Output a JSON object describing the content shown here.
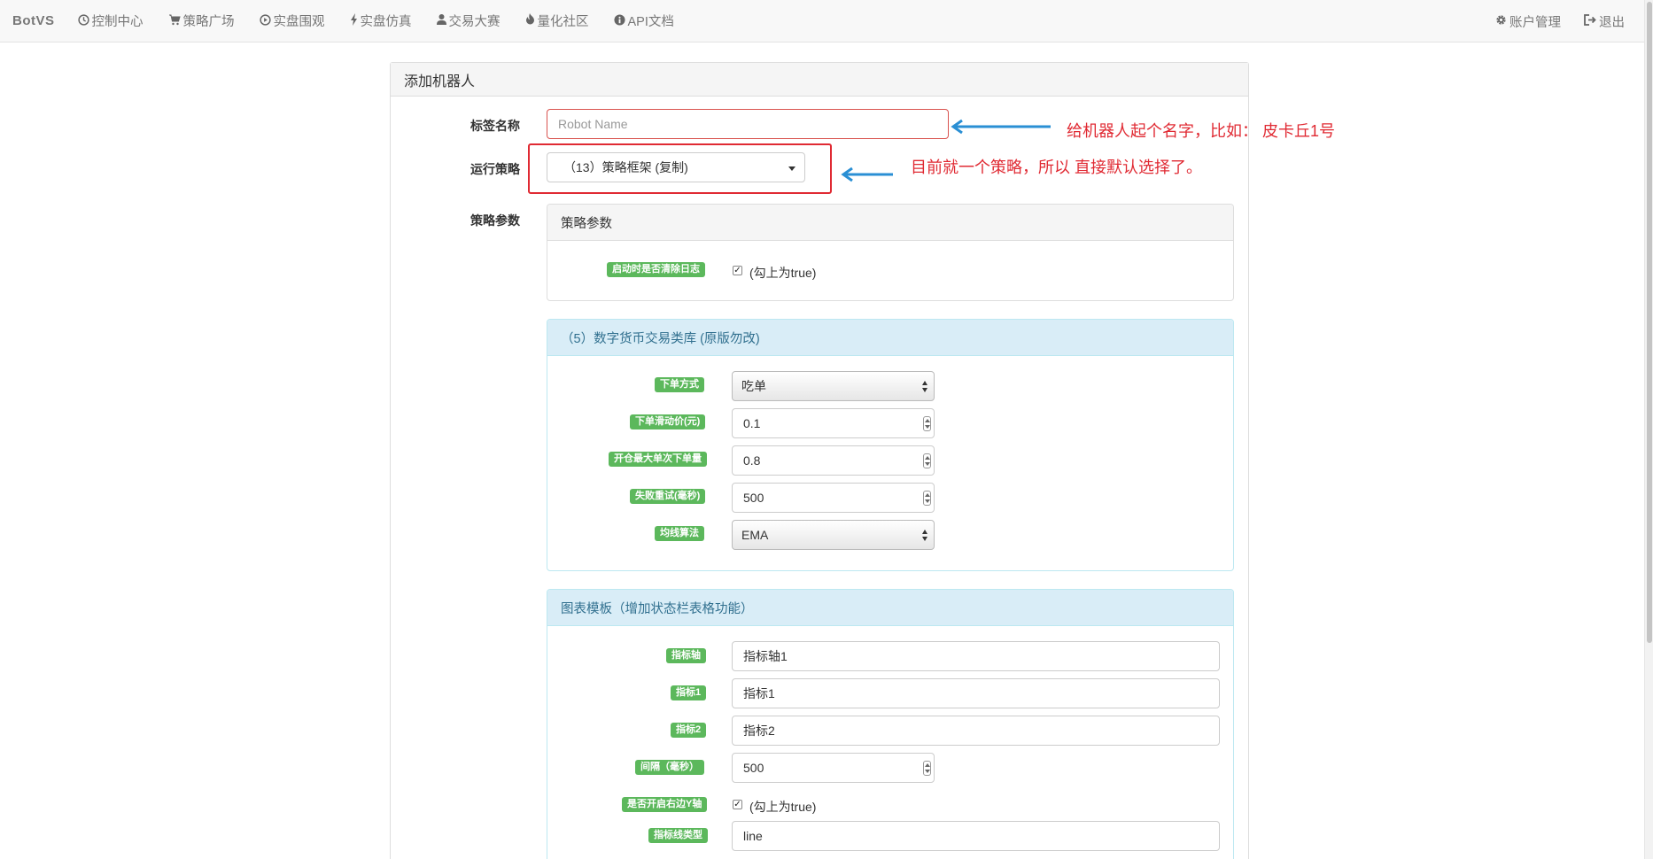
{
  "navbar": {
    "brand": "BotVS",
    "items": [
      {
        "label": "控制中心",
        "icon": "clock-icon"
      },
      {
        "label": "策略广场",
        "icon": "cart-icon"
      },
      {
        "label": "实盘围观",
        "icon": "play-circle-icon"
      },
      {
        "label": "实盘仿真",
        "icon": "bolt-icon"
      },
      {
        "label": "交易大赛",
        "icon": "user-icon"
      },
      {
        "label": "量化社区",
        "icon": "fire-icon"
      },
      {
        "label": "API文档",
        "icon": "info-icon"
      }
    ],
    "right": [
      {
        "label": "账户管理",
        "icon": "gear-icon"
      },
      {
        "label": "退出",
        "icon": "logout-icon"
      }
    ]
  },
  "panel": {
    "title": "添加机器人",
    "name_label": "标签名称",
    "name_placeholder": "Robot Name",
    "strategy_label": "运行策略",
    "strategy_value": "（13）策略框架 (复制)",
    "params_label": "策略参数"
  },
  "annotations": {
    "name_hint": "给机器人起个名字，比如：  皮卡丘1号",
    "strategy_hint": "目前就一个策略，所以 直接默认选择了。"
  },
  "params_panel": {
    "title": "策略参数",
    "clear_log_label": "启动时是否清除日志",
    "clear_log_text": "(勾上为true)",
    "check_mark": "✓"
  },
  "library_panel": {
    "title": "（5）数字货币交易类库 (原版勿改)",
    "fields": [
      {
        "label": "下单方式",
        "value": "吃单"
      },
      {
        "label": "下单滑动价(元)",
        "value": "0.1"
      },
      {
        "label": "开仓最大单次下单量",
        "value": "0.8"
      },
      {
        "label": "失败重试(毫秒)",
        "value": "500"
      },
      {
        "label": "均线算法",
        "value": "EMA"
      }
    ]
  },
  "chart_panel": {
    "title": "图表模板（增加状态栏表格功能）",
    "fields": [
      {
        "label": "指标轴",
        "value": "指标轴1"
      },
      {
        "label": "指标1",
        "value": "指标1"
      },
      {
        "label": "指标2",
        "value": "指标2"
      },
      {
        "label": "间隔（毫秒）",
        "value": "500"
      },
      {
        "label": "是否开启右边Y轴",
        "value": "(勾上为true)"
      },
      {
        "label": "指标线类型",
        "value": "line"
      }
    ]
  },
  "colors": {
    "annotation_red": "#e02a33",
    "arrow_blue": "#2a8fd4",
    "badge_green": "#5cb85c",
    "info_heading": "#d9edf7"
  }
}
